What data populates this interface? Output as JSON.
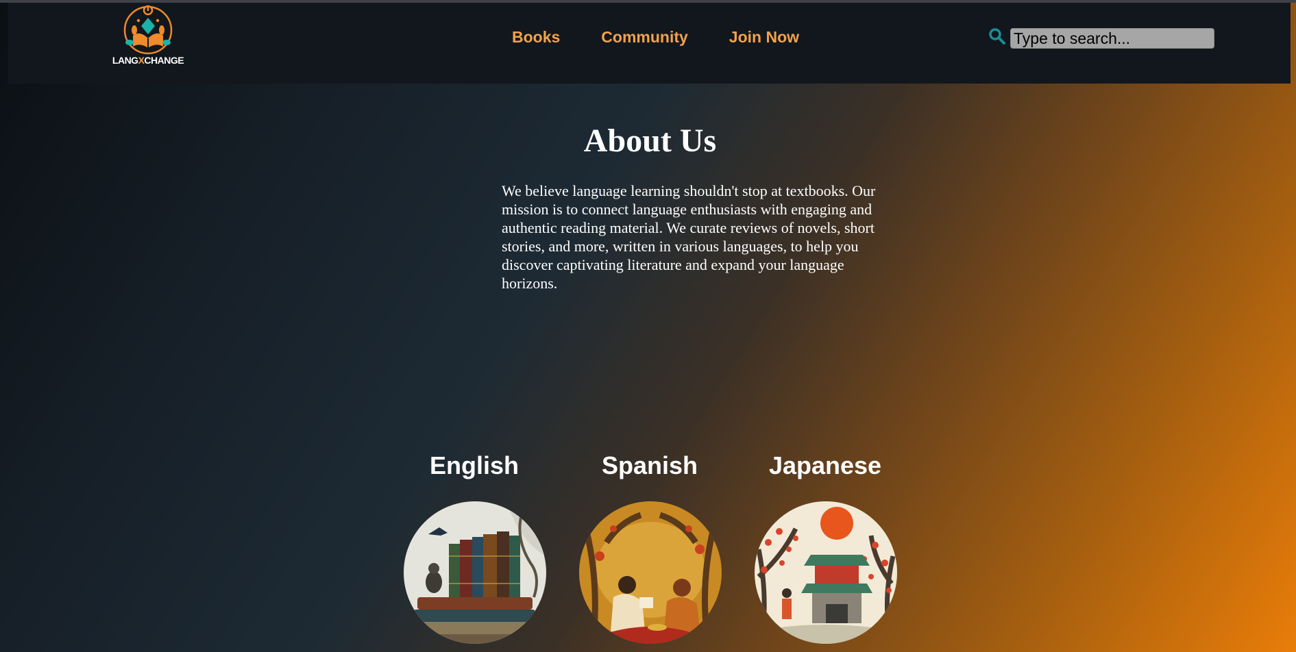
{
  "brand": {
    "logo_part1": "LANG",
    "logo_x": "X",
    "logo_part2": "CHANGE"
  },
  "nav": {
    "links": [
      {
        "label": "Books"
      },
      {
        "label": "Community"
      },
      {
        "label": "Join Now"
      }
    ]
  },
  "search": {
    "placeholder": "Type to search...",
    "icon": "search-icon"
  },
  "about": {
    "title": "About Us",
    "body": "We believe language learning shouldn't stop at textbooks. Our mission is to connect language enthusiasts with engaging and authentic reading material. We curate reviews of novels, short stories, and more, written in various languages, to help you discover captivating literature and expand your language horizons."
  },
  "languages": [
    {
      "name": "English"
    },
    {
      "name": "Spanish"
    },
    {
      "name": "Japanese"
    }
  ],
  "colors": {
    "accent": "#f1a24c",
    "navbar_bg": "#12171d",
    "search_icon": "#1b8e96",
    "gradient_start": "#0b0f13",
    "gradient_end": "#e97d09"
  }
}
